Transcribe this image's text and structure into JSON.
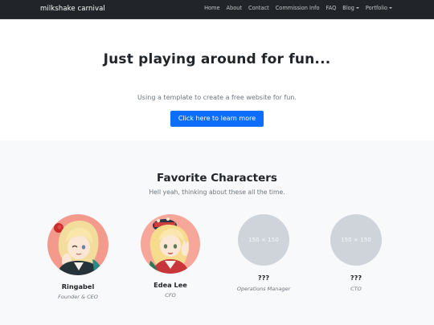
{
  "navbar": {
    "brand": "milkshake carnival",
    "links": [
      {
        "label": "Home"
      },
      {
        "label": "About"
      },
      {
        "label": "Contact"
      },
      {
        "label": "Commission Info"
      },
      {
        "label": "FAQ"
      },
      {
        "label": "Blog"
      },
      {
        "label": "Portfolio"
      }
    ]
  },
  "hero": {
    "title": "Just playing around for fun...",
    "subtitle": "Using a template to create a free website for fun.",
    "button_label": "Click here to learn more"
  },
  "characters": {
    "title": "Favorite Characters",
    "subtitle": "Hell yeah, thinking about these all the time.",
    "items": [
      {
        "name": "Ringabel",
        "role": "Founder & CEO",
        "avatar": "portrait-illustration"
      },
      {
        "name": "Edea Lee",
        "role": "CFO",
        "avatar": "portrait-illustration"
      },
      {
        "name": "???",
        "role": "Operations Manager",
        "placeholder": "150 × 150"
      },
      {
        "name": "???",
        "role": "CTO",
        "placeholder": "150 × 150"
      }
    ]
  },
  "colors": {
    "navbar_bg": "#212529",
    "primary": "#0d6efd",
    "section_bg": "#f8f9fa",
    "placeholder_bg": "#ced4da",
    "avatar_bg": "#f39a8c"
  }
}
